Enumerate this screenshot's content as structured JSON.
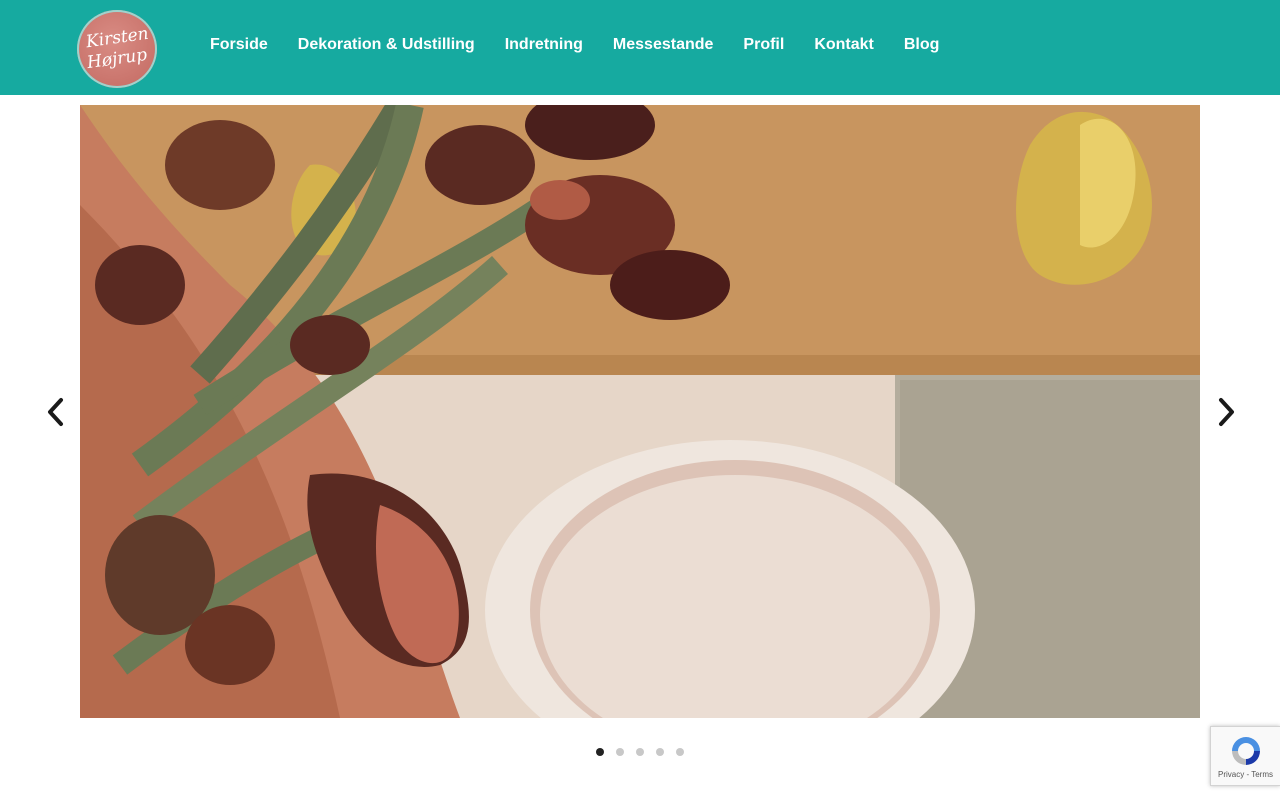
{
  "colors": {
    "header_bg": "#16aaa0",
    "nav_text": "#ffffff",
    "dot_active": "#222222",
    "dot_inactive": "#c8c8c8"
  },
  "logo": {
    "line1": "Kirsten",
    "line2": "Højrup"
  },
  "nav": {
    "items": [
      {
        "label": "Forside"
      },
      {
        "label": "Dekoration & Udstilling"
      },
      {
        "label": "Indretning"
      },
      {
        "label": "Messestande"
      },
      {
        "label": "Profil"
      },
      {
        "label": "Kontakt"
      },
      {
        "label": "Blog"
      }
    ]
  },
  "slider": {
    "total_slides": 5,
    "active_slide": 1,
    "prev_icon": "chevron-left-icon",
    "next_icon": "chevron-right-icon"
  },
  "recaptcha": {
    "links": "Privacy - Terms"
  }
}
